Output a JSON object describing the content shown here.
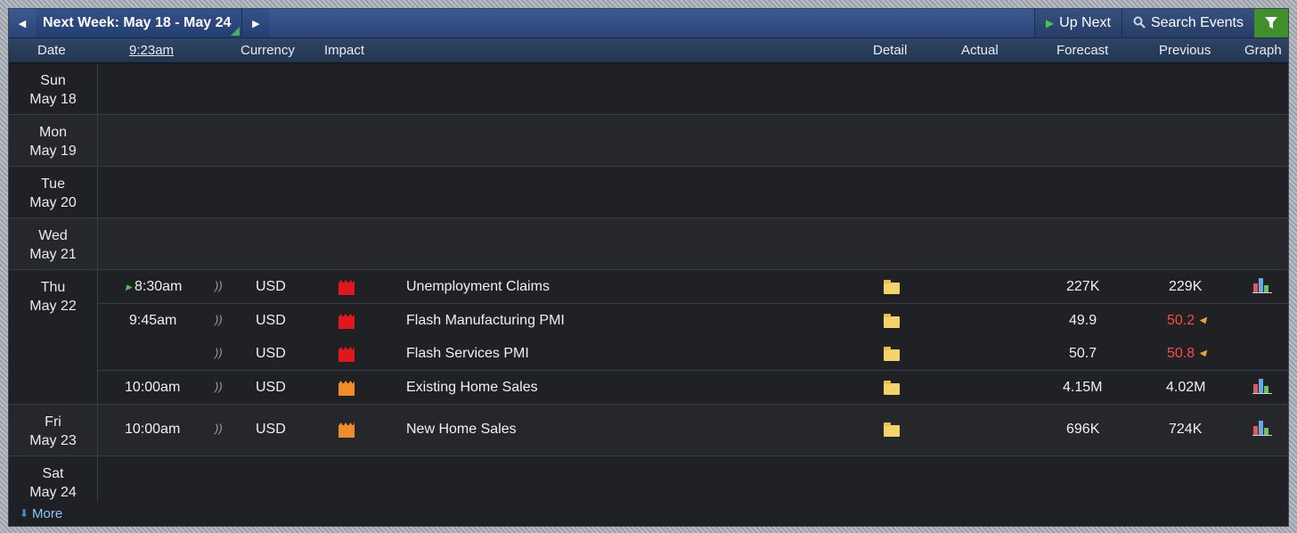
{
  "topbar": {
    "prev_label": "◀",
    "next_label": "▶",
    "week_title": "Next Week: May 18 - May 24",
    "up_next": "Up Next",
    "search": "Search Events"
  },
  "header": {
    "date": "Date",
    "time": "9:23am",
    "currency": "Currency",
    "impact": "Impact",
    "detail": "Detail",
    "actual": "Actual",
    "forecast": "Forecast",
    "previous": "Previous",
    "graph": "Graph"
  },
  "days": [
    {
      "dow": "Sun",
      "date": "May 18"
    },
    {
      "dow": "Mon",
      "date": "May 19"
    },
    {
      "dow": "Tue",
      "date": "May 20"
    },
    {
      "dow": "Wed",
      "date": "May 21"
    },
    {
      "dow": "Thu",
      "date": "May 22"
    },
    {
      "dow": "Fri",
      "date": "May 23"
    },
    {
      "dow": "Sat",
      "date": "May 24"
    }
  ],
  "events": [
    {
      "time": "8:30am",
      "currency": "USD",
      "impact": "high",
      "name": "Unemployment Claims",
      "forecast": "227K",
      "previous": "229K",
      "previous_revised": false,
      "graph": true
    },
    {
      "time": "9:45am",
      "currency": "USD",
      "impact": "high",
      "name": "Flash Manufacturing PMI",
      "forecast": "49.9",
      "previous": "50.2",
      "previous_revised": true,
      "graph": false
    },
    {
      "time": "",
      "currency": "USD",
      "impact": "high",
      "name": "Flash Services PMI",
      "forecast": "50.7",
      "previous": "50.8",
      "previous_revised": true,
      "graph": false
    },
    {
      "time": "10:00am",
      "currency": "USD",
      "impact": "medium",
      "name": "Existing Home Sales",
      "forecast": "4.15M",
      "previous": "4.02M",
      "previous_revised": false,
      "graph": true
    },
    {
      "time": "10:00am",
      "currency": "USD",
      "impact": "medium",
      "name": "New Home Sales",
      "forecast": "696K",
      "previous": "724K",
      "previous_revised": false,
      "graph": true
    }
  ],
  "icons": {
    "impact_high_color": "#e0181d",
    "impact_medium_color": "#f08c2a",
    "revised_color": "#ff4a4a"
  },
  "footer": {
    "more": "More"
  }
}
